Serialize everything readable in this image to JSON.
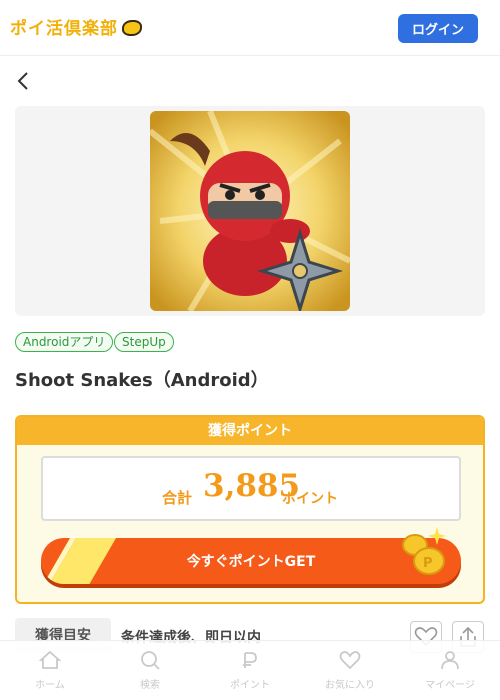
{
  "header": {
    "logo_text": "ポイ活倶楽部",
    "login_label": "ログイン"
  },
  "tags": [
    "Androidアプリ",
    "StepUp"
  ],
  "title": "Shoot Snakes（Android）",
  "points": {
    "header": "獲得ポイント",
    "total_label": "合計",
    "total_value": "3,885",
    "unit": "ポイント",
    "get_button": "今すぐポイントGET"
  },
  "estimate": {
    "label": "獲得目安",
    "text": "条件達成後、即日以内"
  },
  "nav": [
    {
      "label": "ホーム",
      "icon": "home-icon"
    },
    {
      "label": "検索",
      "icon": "search-icon"
    },
    {
      "label": "ポイント",
      "icon": "point-icon"
    },
    {
      "label": "お気に入り",
      "icon": "heart-icon"
    },
    {
      "label": "マイページ",
      "icon": "user-icon"
    }
  ],
  "colors": {
    "brand": "#f2b10a",
    "login_blue": "#2f6fe0",
    "tag_green": "#3bb34a",
    "points_orange": "#f39a1a",
    "cta_orange": "#f55a19"
  }
}
